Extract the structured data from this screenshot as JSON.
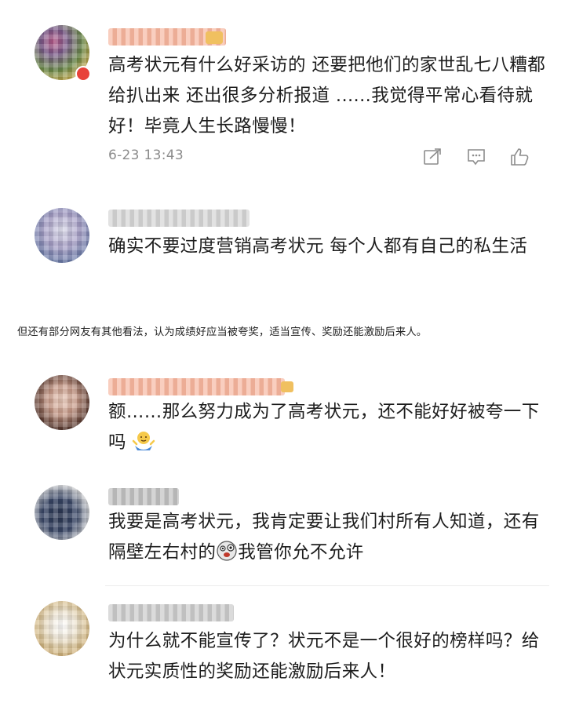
{
  "comments": [
    {
      "text": "高考状元有什么好采访的 还要把他们的家世乱七八糟都给扒出来 还出很多分析报道 ......我觉得平常心看待就好！毕竟人生长路慢慢！",
      "timestamp": "6-23 13:43",
      "actions": [
        "share-icon",
        "comment-icon",
        "like-icon"
      ]
    },
    {
      "text": "确实不要过度营销高考状元 每个人都有自己的私生活"
    },
    {
      "text": "额……那么努力成为了高考状元，还不能好好被夸一下吗",
      "emoji": "shrug-emoji"
    },
    {
      "text_before": "我要是高考状元，我肯定要让我们村所有人知道，还有隔壁左右村的",
      "emoji": "crazy-face-emoji",
      "text_after": "我管你允不允许"
    },
    {
      "text": "为什么就不能宣传了？状元不是一个很好的榜样吗？给状元实质性的奖励还能激励后来人！"
    }
  ],
  "caption": "但还有部分网友有其他看法，认为成绩好应当被夸奖，适当宣传、奖励还能激励后来人。",
  "colors": {
    "text": "#1d1d1d",
    "meta": "#8c8c8c",
    "username_blur": "#f2a58a"
  }
}
